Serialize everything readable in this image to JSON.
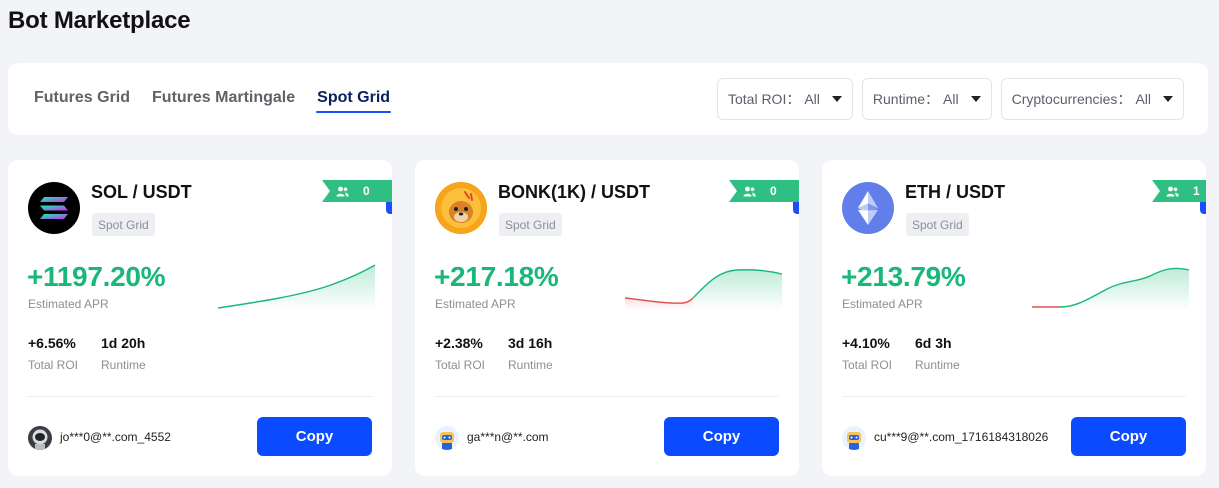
{
  "page": {
    "title": "Bot Marketplace"
  },
  "tabs": [
    {
      "label": "Futures Grid",
      "active": false
    },
    {
      "label": "Futures Martingale",
      "active": false
    },
    {
      "label": "Spot Grid",
      "active": true
    }
  ],
  "filters": [
    {
      "label": "Total ROI：",
      "value": "All"
    },
    {
      "label": "Runtime：",
      "value": "All"
    },
    {
      "label": "Cryptocurrencies：",
      "value": "All"
    }
  ],
  "colors": {
    "positive": "#19b779",
    "negative": "#e05252",
    "accent": "#0a4bff",
    "badge": "#2fbf83"
  },
  "cards": [
    {
      "pair": "SOL / USDT",
      "coin_icon": "solana-logo",
      "type": "Spot Grid",
      "copiers": "0",
      "apr": "+1197.20%",
      "apr_label": "Estimated APR",
      "total_roi": "+6.56%",
      "total_roi_label": "Total ROI",
      "runtime": "1d 20h",
      "runtime_label": "Runtime",
      "owner": "jo***0@**.com_4552",
      "owner_avatar": "astronaut-avatar",
      "copy_label": "Copy"
    },
    {
      "pair": "BONK(1K) / USDT",
      "coin_icon": "bonk-logo",
      "type": "Spot Grid",
      "copiers": "0",
      "apr": "+217.18%",
      "apr_label": "Estimated APR",
      "total_roi": "+2.38%",
      "total_roi_label": "Total ROI",
      "runtime": "3d 16h",
      "runtime_label": "Runtime",
      "owner": "ga***n@**.com",
      "owner_avatar": "robot-avatar",
      "copy_label": "Copy"
    },
    {
      "pair": "ETH / USDT",
      "coin_icon": "ethereum-logo",
      "type": "Spot Grid",
      "copiers": "1",
      "apr": "+213.79%",
      "apr_label": "Estimated APR",
      "total_roi": "+4.10%",
      "total_roi_label": "Total ROI",
      "runtime": "6d 3h",
      "runtime_label": "Runtime",
      "owner": "cu***9@**.com_1716184318026",
      "owner_avatar": "robot-avatar",
      "copy_label": "Copy"
    }
  ]
}
